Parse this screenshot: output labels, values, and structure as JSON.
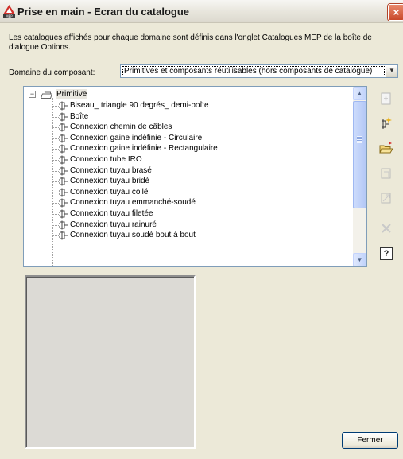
{
  "window": {
    "title": "Prise en main - Ecran du catalogue",
    "close_label": "×"
  },
  "description": "Les catalogues affichés pour chaque domaine sont définis dans l'onglet Catalogues MEP de la boîte de dialogue Options.",
  "domain": {
    "label_underlined": "D",
    "label_rest": "omaine du composant:",
    "selected_value": "Primitives et composants réutilisables (hors composants de catalogue)"
  },
  "tree": {
    "root": {
      "label": "Primitive",
      "expander": "−"
    },
    "items": [
      {
        "label": "Biseau_ triangle 90 degrés_ demi-boîte"
      },
      {
        "label": "Boîte"
      },
      {
        "label": "Connexion chemin de câbles"
      },
      {
        "label": "Connexion gaine indéfinie - Circulaire"
      },
      {
        "label": "Connexion gaine indéfinie - Rectangulaire"
      },
      {
        "label": "Connexion tube IRO"
      },
      {
        "label": "Connexion tuyau brasé"
      },
      {
        "label": "Connexion tuyau bridé"
      },
      {
        "label": "Connexion tuyau collé"
      },
      {
        "label": "Connexion tuyau emmanché-soudé"
      },
      {
        "label": "Connexion tuyau filetée"
      },
      {
        "label": "Connexion tuyau rainuré"
      },
      {
        "label": "Connexion tuyau soudé bout à bout"
      }
    ]
  },
  "side_buttons": [
    {
      "name": "new-part-icon",
      "enabled": false
    },
    {
      "name": "add-component-icon",
      "enabled": true
    },
    {
      "name": "open-folder-icon",
      "enabled": true
    },
    {
      "name": "edit-part-icon",
      "enabled": false
    },
    {
      "name": "copy-part-icon",
      "enabled": false
    },
    {
      "name": "delete-icon",
      "enabled": false
    },
    {
      "name": "help-icon",
      "enabled": true,
      "glyph": "?"
    }
  ],
  "footer": {
    "close_button_label": "Fermer"
  },
  "colors": {
    "accent_close": "#c8482a",
    "scrollbar": "#c1d3fb"
  }
}
